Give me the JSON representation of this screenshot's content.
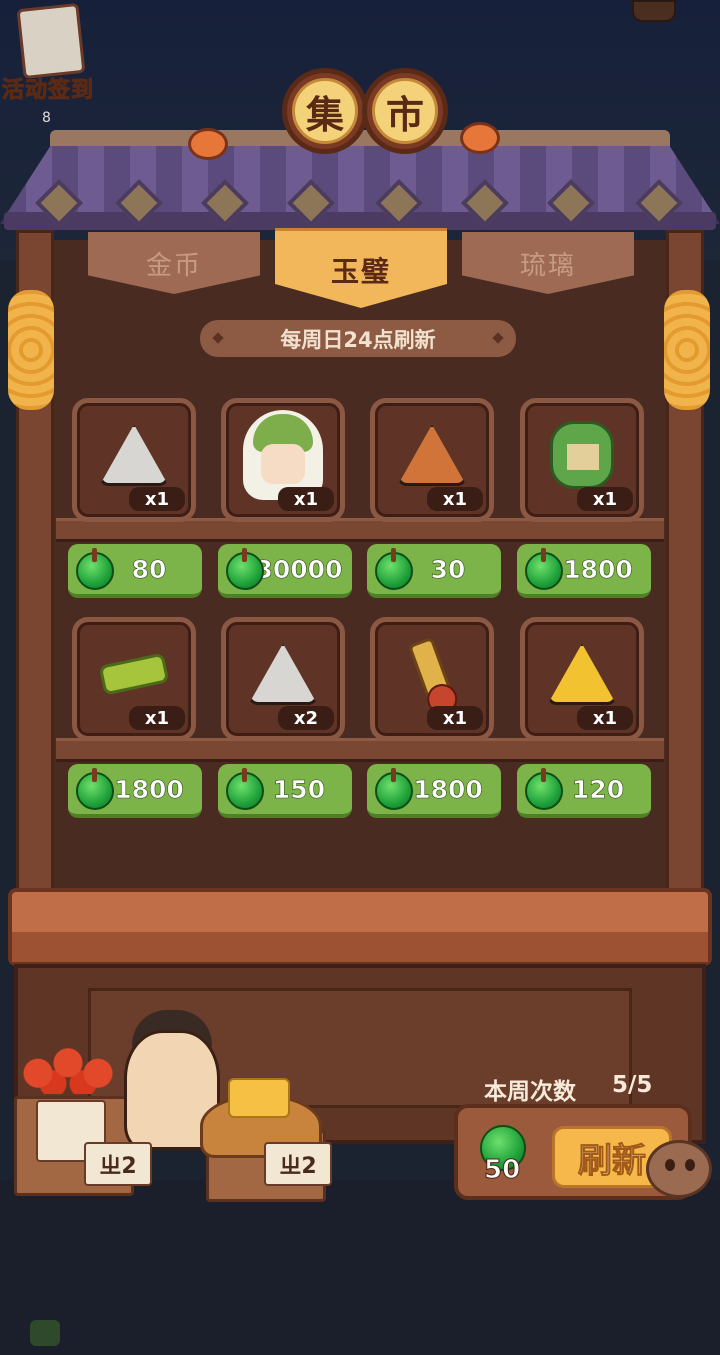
{
  "header": {
    "activity_label": "活动签到",
    "activity_sub": "8",
    "sign_chars": [
      "集",
      "市"
    ]
  },
  "tabs": [
    {
      "label": "金币",
      "active": false
    },
    {
      "label": "玉璧",
      "active": true
    },
    {
      "label": "琉璃",
      "active": false
    }
  ],
  "refresh_notice": "每周日24点刷新",
  "currency": {
    "name": "jade",
    "color": "#1fa23a"
  },
  "items": [
    {
      "icon": "white-spiral-rune-icon",
      "qty": "x1",
      "price": "80"
    },
    {
      "icon": "green-hooded-character-icon",
      "qty": "x1",
      "price": "30000"
    },
    {
      "icon": "orange-rune-icon",
      "qty": "x1",
      "price": "30"
    },
    {
      "icon": "green-scroll-ornament-icon",
      "qty": "x1",
      "price": "1800"
    },
    {
      "icon": "green-ribbon-ornament-icon",
      "qty": "x1",
      "price": "1800"
    },
    {
      "icon": "white-leaf-rune-icon",
      "qty": "x2",
      "price": "150"
    },
    {
      "icon": "key-doll-ornament-icon",
      "qty": "x1",
      "price": "1800"
    },
    {
      "icon": "yellow-antler-rune-icon",
      "qty": "x1",
      "price": "120"
    }
  ],
  "weekly": {
    "label": "本周次数",
    "count": "5/5"
  },
  "refresh": {
    "cost": "50",
    "button_label": "刷新"
  },
  "stall_tags": [
    "ㄓ2",
    "ㄓ2"
  ]
}
